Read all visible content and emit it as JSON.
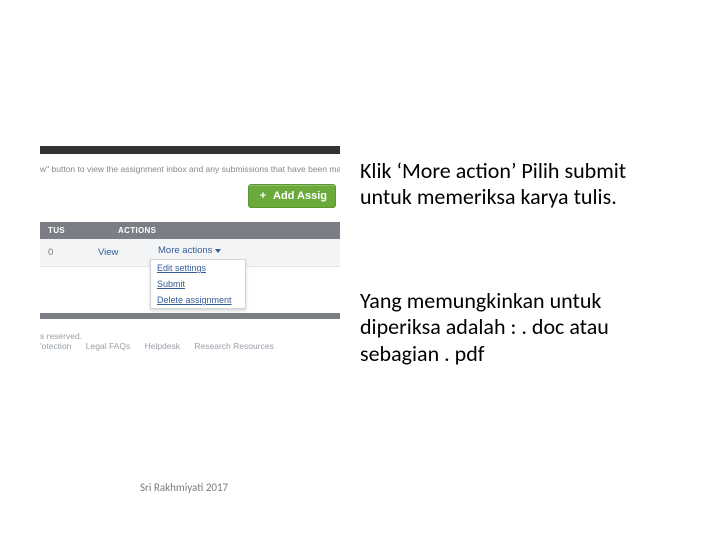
{
  "screenshot": {
    "description_fragment": "w\" button to view the assignment inbox and any submissions that have been made to the ass...",
    "add_button": "Add Assig",
    "columns": {
      "status": "TUS",
      "actions": "ACTIONS"
    },
    "row": {
      "col1": "0",
      "view_label": "View",
      "more_label": "More actions"
    },
    "menu": {
      "edit": "Edit settings",
      "submit": "Submit",
      "delete": "Delete assignment"
    },
    "footer": {
      "reserved": "s reserved.",
      "links": [
        "'otection",
        "Legal FAQs",
        "Helpdesk",
        "Research Resources"
      ]
    }
  },
  "instructions": {
    "para1": "Klik ‘More action’ Pilih submit untuk memeriksa karya tulis.",
    "para2": "Yang memungkinkan untuk diperiksa adalah : . doc atau sebagian . pdf"
  },
  "credit": "Sri Rakhmiyati 2017"
}
